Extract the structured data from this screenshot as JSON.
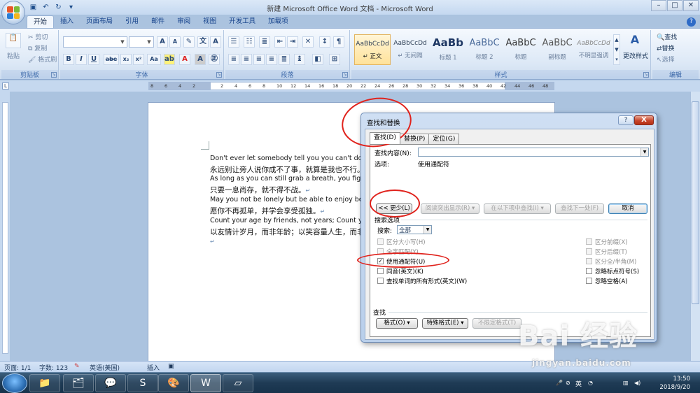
{
  "window": {
    "title": "新建 Microsoft Office Word 文档 - Microsoft Word"
  },
  "ribbon": {
    "tabs": [
      "开始",
      "插入",
      "页面布局",
      "引用",
      "邮件",
      "审阅",
      "视图",
      "开发工具",
      "加载项"
    ],
    "clipboard": {
      "paste": "粘贴",
      "cut": "剪切",
      "copy": "复制",
      "format_painter": "格式刷",
      "label": "剪贴板"
    },
    "font": {
      "label": "字体",
      "bold": "B",
      "italic": "I",
      "underline": "U",
      "strike": "abe",
      "sub": "x₂",
      "sup": "x²",
      "aa": "Aa",
      "grow": "A",
      "shrink": "A"
    },
    "paragraph": {
      "label": "段落"
    },
    "styles": {
      "label": "样式",
      "change_styles": "更改样式",
      "items": [
        {
          "sample": "AaBbCcDd",
          "name": "↵ 正文"
        },
        {
          "sample": "AaBbCcDd",
          "name": "↵ 无间隔"
        },
        {
          "sample": "AaBb",
          "name": "标题 1"
        },
        {
          "sample": "AaBbC",
          "name": "标题 2"
        },
        {
          "sample": "AaBbC",
          "name": "标题"
        },
        {
          "sample": "AaBbC",
          "name": "副标题"
        },
        {
          "sample": "AaBbCcDd",
          "name": "不明显强调"
        }
      ]
    },
    "editing": {
      "label": "编辑",
      "find": "查找",
      "replace": "替换",
      "select": "选择"
    }
  },
  "ruler": {
    "numbers": [
      "8",
      "6",
      "4",
      "2",
      "",
      "2",
      "4",
      "6",
      "8",
      "10",
      "12",
      "14",
      "16",
      "18",
      "20",
      "22",
      "24",
      "26",
      "28",
      "30",
      "32",
      "34",
      "36",
      "38",
      "40",
      "42",
      "44",
      "46",
      "48"
    ]
  },
  "document": {
    "lines": [
      "Don't ever let somebody tell you you can't do somet",
      "永远别让旁人说你成不了事，就算是我也不行。",
      "As long as you can still grab a breath, you fight.",
      "只要一息尚存，就不得不战。",
      "May you not be lonely but be able to enjoy being alo",
      "愿你不再孤单，并学会享受孤独。",
      "Count your age by friends, not years; Count your life",
      "以友情计岁月，而非年龄；以笑容量人生，而非"
    ],
    "para_mark": "↵"
  },
  "dialog": {
    "title": "查找和替换",
    "help": "?",
    "close": "X",
    "tabs": [
      "查找(D)",
      "替换(P)",
      "定位(G)"
    ],
    "find_label": "查找内容(N):",
    "find_value": "",
    "options_label": "选项:",
    "options_value": "使用通配符",
    "btn_less": "<< 更少(L)",
    "btn_highlight": "阅读突出显示(R) ▾",
    "btn_find_in": "在以下项中查找(I) ▾",
    "btn_find_next": "查找下一处(F)",
    "btn_cancel": "取消",
    "search_options_label": "搜索选项",
    "search_label": "搜索:",
    "search_value": "全部",
    "left_checks": [
      {
        "label": "区分大小写(H)",
        "checked": false,
        "enabled": false
      },
      {
        "label": "全字匹配(Y)",
        "checked": false,
        "enabled": false
      },
      {
        "label": "使用通配符(U)",
        "checked": true,
        "enabled": true
      },
      {
        "label": "同音(英文)(K)",
        "checked": false,
        "enabled": true
      },
      {
        "label": "查找单词的所有形式(英文)(W)",
        "checked": false,
        "enabled": true
      }
    ],
    "right_checks": [
      {
        "label": "区分前缀(X)",
        "checked": false,
        "enabled": false
      },
      {
        "label": "区分后缀(T)",
        "checked": false,
        "enabled": false
      },
      {
        "label": "区分全/半角(M)",
        "checked": false,
        "enabled": false
      },
      {
        "label": "忽略标点符号(S)",
        "checked": false,
        "enabled": true
      },
      {
        "label": "忽略空格(A)",
        "checked": false,
        "enabled": true
      }
    ],
    "find_section_label": "查找",
    "btn_format": "格式(O) ▾",
    "btn_special": "特殊格式(E) ▾",
    "btn_no_format": "不限定格式(T)"
  },
  "statusbar": {
    "page": "页面: 1/1",
    "words": "字数: 123",
    "language": "英语(美国)",
    "insert": "插入"
  },
  "taskbar": {
    "time": "13:50",
    "date": "2018/9/20",
    "ime": "英"
  },
  "watermark": {
    "brand": "Bai 经验",
    "url": "jingyan.baidu.com"
  },
  "colors": {
    "annotation": "#e0221c",
    "ribbon_bg": "#dce8f6",
    "doc_bg": "#abc3df"
  }
}
